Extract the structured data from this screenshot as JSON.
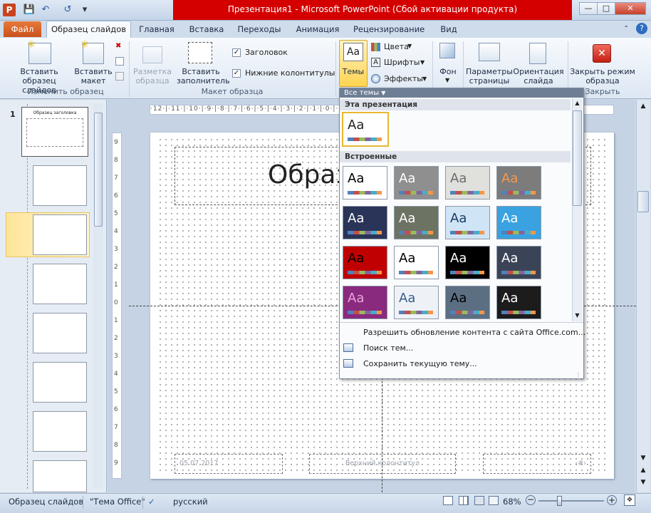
{
  "window": {
    "title": "Презентация1  -  Microsoft PowerPoint (Сбой активации продукта)",
    "app_icon": "P"
  },
  "quick_access": [
    "save-icon",
    "undo-icon",
    "redo-icon",
    "customize-icon"
  ],
  "tabs": {
    "file": "Файл",
    "active": "Образец слайдов",
    "items": [
      "Главная",
      "Вставка",
      "Переходы",
      "Анимация",
      "Рецензирование",
      "Вид"
    ]
  },
  "ribbon": {
    "insert_master": "Вставить\nобразец слайдов",
    "insert_layout": "Вставить\nмакет",
    "group_edit_master": "Изменить образец",
    "master_layout": "Разметка\nобразца",
    "insert_placeholder": "Вставить\nзаполнитель",
    "title_check": "Заголовок",
    "footers_check": "Нижние колонтитулы",
    "group_master_layout": "Макет образца",
    "themes": "Темы",
    "colors": "Цвета",
    "fonts": "Шрифты",
    "effects": "Эффекты",
    "background": "Фон",
    "page_setup": "Параметры\nстраницы",
    "orientation": "Ориентация\nслайда",
    "close_master": "Закрыть режим\nобразца",
    "group_close": "Закрыть"
  },
  "thumbnails": {
    "first_number": "1",
    "first_title": "Образец заголовка"
  },
  "ruler_h": "·12·|·11·|·10·|·9·|·8·|·7·|·6·|·5·|·4·|·3·|·2·|·1·|·0·|·1·|·2·|·3·|·4·|·5·|·6·|·7·|·8·|·9·|·10·|·11·|·12·",
  "ruler_v": [
    "9",
    "8",
    "7",
    "6",
    "5",
    "4",
    "3",
    "2",
    "1",
    "0",
    "1",
    "2",
    "3",
    "4",
    "5",
    "6",
    "7",
    "8",
    "9"
  ],
  "slide": {
    "title": "Образ",
    "date": "05.07.2017",
    "footer": "Верхний колонтитул",
    "number": "‹#›"
  },
  "dropdown": {
    "header": "Все темы",
    "section_current": "Эта презентация",
    "section_builtin": "Встроенные",
    "theme_label": "Aa",
    "enable_updates": "Разрешить обновление контента с сайта Office.com...",
    "browse": "Поиск тем...",
    "save_theme": "Сохранить текущую тему..."
  },
  "themes_builtin": [
    {
      "bg": "#ffffff",
      "fg": "#000000"
    },
    {
      "bg": "#8f8f8f",
      "fg": "#ffffff"
    },
    {
      "bg": "#e0e0dc",
      "fg": "#6c6c6c"
    },
    {
      "bg": "#7c7c7c",
      "fg": "#f59a4e"
    },
    {
      "bg": "#2a3458",
      "fg": "#ffffff"
    },
    {
      "bg": "#6d7363",
      "fg": "#ffffff"
    },
    {
      "bg": "#cfe4f5",
      "fg": "#1a3c66"
    },
    {
      "bg": "#3aa2e0",
      "fg": "#ffffff"
    },
    {
      "bg": "#c00000",
      "fg": "#000000"
    },
    {
      "bg": "#ffffff",
      "fg": "#000000"
    },
    {
      "bg": "#000000",
      "fg": "#ffffff"
    },
    {
      "bg": "#3b4457",
      "fg": "#ffffff"
    },
    {
      "bg": "#8a2a7f",
      "fg": "#e7a7d8"
    },
    {
      "bg": "#eef2f7",
      "fg": "#3a5c8c"
    },
    {
      "bg": "#5c6f82",
      "fg": "#000000"
    },
    {
      "bg": "#1c1c1c",
      "fg": "#ffffff"
    }
  ],
  "status": {
    "mode": "Образец слайдов",
    "theme": "\"Тема Office\"",
    "language": "русский",
    "zoom": "68%"
  },
  "colors": {
    "title_bar_alert": "#d40000",
    "file_tab": "#d95f23",
    "selection": "#ffe59a"
  }
}
